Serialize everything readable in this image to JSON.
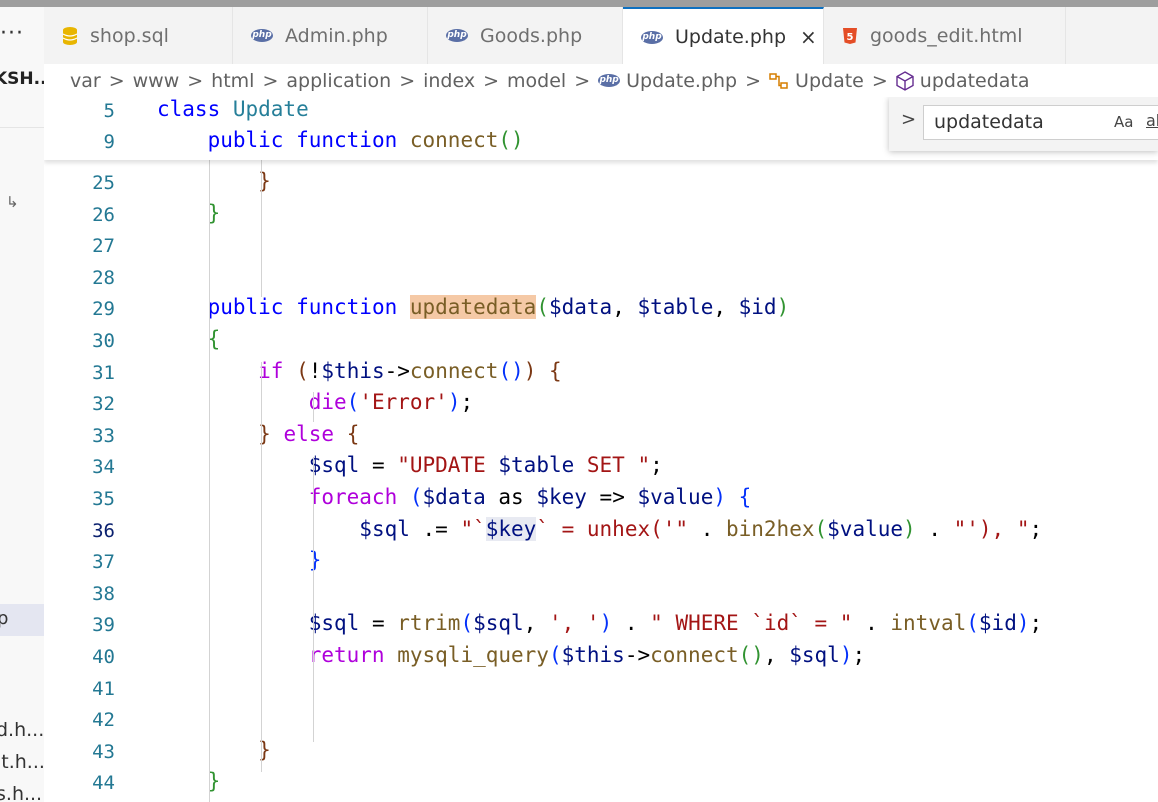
{
  "sidebar": {
    "menu_dots": "···",
    "workspace_title": "KSH...",
    "arrow_glyph": "↳",
    "selected_label": "p",
    "files": [
      "d.h...",
      "it.h...",
      "s.h..."
    ]
  },
  "tabs": [
    {
      "label": "shop.sql",
      "icon": "database-icon",
      "active": false
    },
    {
      "label": "Admin.php",
      "icon": "php-icon",
      "active": false
    },
    {
      "label": "Goods.php",
      "icon": "php-icon",
      "active": false
    },
    {
      "label": "Update.php",
      "icon": "php-icon",
      "active": true,
      "close": "×"
    },
    {
      "label": "goods_edit.html",
      "icon": "html5-icon",
      "active": false
    }
  ],
  "php_badge_text": "php",
  "html5_badge_text": "5",
  "breadcrumb": {
    "segments": [
      "var",
      "www",
      "html",
      "application",
      "index",
      "model"
    ],
    "file": "Update.php",
    "class_name": "Update",
    "method": "updatedata",
    "separator": ">"
  },
  "find_widget": {
    "query": "updatedata",
    "toggle_glyph": ">",
    "match_case_label": "Aa",
    "whole_word_label": "ab"
  },
  "sticky_lines": [
    {
      "num": "5",
      "tokens": [
        {
          "t": "class ",
          "c": "kw"
        },
        {
          "t": "Update",
          "c": "cls"
        }
      ]
    },
    {
      "num": "9",
      "tokens": [
        {
          "t": "    "
        },
        {
          "t": "public function ",
          "c": "kw"
        },
        {
          "t": "connect",
          "c": "fn"
        },
        {
          "t": "(",
          "c": "br2"
        },
        {
          "t": ")",
          "c": "br2"
        }
      ]
    }
  ],
  "code_lines": [
    {
      "num": "25",
      "tokens": [
        {
          "t": "        "
        },
        {
          "t": "}",
          "c": "br3"
        }
      ]
    },
    {
      "num": "26",
      "tokens": [
        {
          "t": "    "
        },
        {
          "t": "}",
          "c": "br2"
        }
      ]
    },
    {
      "num": "27",
      "tokens": []
    },
    {
      "num": "28",
      "tokens": []
    },
    {
      "num": "29",
      "tokens": [
        {
          "t": "    "
        },
        {
          "t": "public function ",
          "c": "kw"
        },
        {
          "t": "updatedata",
          "c": "fn hl"
        },
        {
          "t": "(",
          "c": "br2"
        },
        {
          "t": "$data",
          "c": "var"
        },
        {
          "t": ", "
        },
        {
          "t": "$table",
          "c": "var"
        },
        {
          "t": ", "
        },
        {
          "t": "$id",
          "c": "var"
        },
        {
          "t": ")",
          "c": "br2"
        }
      ]
    },
    {
      "num": "30",
      "tokens": [
        {
          "t": "    "
        },
        {
          "t": "{",
          "c": "br2"
        }
      ]
    },
    {
      "num": "31",
      "tokens": [
        {
          "t": "        "
        },
        {
          "t": "if ",
          "c": "ctl"
        },
        {
          "t": "(",
          "c": "br3"
        },
        {
          "t": "!"
        },
        {
          "t": "$this",
          "c": "var"
        },
        {
          "t": "->"
        },
        {
          "t": "connect",
          "c": "fn"
        },
        {
          "t": "()",
          "c": "br1"
        },
        {
          "t": ")",
          "c": "br3"
        },
        {
          "t": " "
        },
        {
          "t": "{",
          "c": "br3"
        }
      ]
    },
    {
      "num": "32",
      "tokens": [
        {
          "t": "            "
        },
        {
          "t": "die",
          "c": "ctl"
        },
        {
          "t": "(",
          "c": "br1"
        },
        {
          "t": "'Error'",
          "c": "str"
        },
        {
          "t": ")",
          "c": "br1"
        },
        {
          "t": ";"
        }
      ]
    },
    {
      "num": "33",
      "tokens": [
        {
          "t": "        "
        },
        {
          "t": "}",
          "c": "br3"
        },
        {
          "t": " "
        },
        {
          "t": "else ",
          "c": "ctl"
        },
        {
          "t": "{",
          "c": "br3"
        }
      ]
    },
    {
      "num": "34",
      "tokens": [
        {
          "t": "            "
        },
        {
          "t": "$sql",
          "c": "var"
        },
        {
          "t": " = "
        },
        {
          "t": "\"UPDATE ",
          "c": "str"
        },
        {
          "t": "$table",
          "c": "var"
        },
        {
          "t": " SET \"",
          "c": "str"
        },
        {
          "t": ";"
        }
      ]
    },
    {
      "num": "35",
      "tokens": [
        {
          "t": "            "
        },
        {
          "t": "foreach ",
          "c": "ctl"
        },
        {
          "t": "(",
          "c": "br1"
        },
        {
          "t": "$data",
          "c": "var"
        },
        {
          "t": " as "
        },
        {
          "t": "$key",
          "c": "var"
        },
        {
          "t": " => "
        },
        {
          "t": "$value",
          "c": "var"
        },
        {
          "t": ")",
          "c": "br1"
        },
        {
          "t": " "
        },
        {
          "t": "{",
          "c": "br1"
        }
      ]
    },
    {
      "num": "36",
      "tokens": [
        {
          "t": "                "
        },
        {
          "t": "$sql",
          "c": "var"
        },
        {
          "t": " .= "
        },
        {
          "t": "\"`",
          "c": "str"
        },
        {
          "t": "$key",
          "c": "var wh"
        },
        {
          "t": "` = unhex('\"",
          "c": "str"
        },
        {
          "t": " . "
        },
        {
          "t": "bin2hex",
          "c": "fn"
        },
        {
          "t": "(",
          "c": "br2"
        },
        {
          "t": "$value",
          "c": "var"
        },
        {
          "t": ")",
          "c": "br2"
        },
        {
          "t": " . "
        },
        {
          "t": "\"'), \"",
          "c": "str"
        },
        {
          "t": ";"
        }
      ]
    },
    {
      "num": "37",
      "tokens": [
        {
          "t": "            "
        },
        {
          "t": "}",
          "c": "br1"
        }
      ]
    },
    {
      "num": "38",
      "tokens": []
    },
    {
      "num": "39",
      "tokens": [
        {
          "t": "            "
        },
        {
          "t": "$sql",
          "c": "var"
        },
        {
          "t": " = "
        },
        {
          "t": "rtrim",
          "c": "fn"
        },
        {
          "t": "(",
          "c": "br1"
        },
        {
          "t": "$sql",
          "c": "var"
        },
        {
          "t": ", "
        },
        {
          "t": "', '",
          "c": "str"
        },
        {
          "t": ")",
          "c": "br1"
        },
        {
          "t": " . "
        },
        {
          "t": "\" WHERE `id` = \"",
          "c": "str"
        },
        {
          "t": " . "
        },
        {
          "t": "intval",
          "c": "fn"
        },
        {
          "t": "(",
          "c": "br1"
        },
        {
          "t": "$id",
          "c": "var"
        },
        {
          "t": ")",
          "c": "br1"
        },
        {
          "t": ";"
        }
      ]
    },
    {
      "num": "40",
      "tokens": [
        {
          "t": "            "
        },
        {
          "t": "return ",
          "c": "ctl"
        },
        {
          "t": "mysqli_query",
          "c": "fn"
        },
        {
          "t": "(",
          "c": "br1"
        },
        {
          "t": "$this",
          "c": "var"
        },
        {
          "t": "->"
        },
        {
          "t": "connect",
          "c": "fn"
        },
        {
          "t": "()",
          "c": "br2"
        },
        {
          "t": ", "
        },
        {
          "t": "$sql",
          "c": "var"
        },
        {
          "t": ")",
          "c": "br1"
        },
        {
          "t": ";"
        }
      ]
    },
    {
      "num": "41",
      "tokens": []
    },
    {
      "num": "42",
      "tokens": []
    },
    {
      "num": "43",
      "tokens": [
        {
          "t": "        "
        },
        {
          "t": "}",
          "c": "br3"
        }
      ]
    },
    {
      "num": "44",
      "tokens": [
        {
          "t": "    "
        },
        {
          "t": "}",
          "c": "br2"
        }
      ]
    }
  ],
  "current_line": "36"
}
